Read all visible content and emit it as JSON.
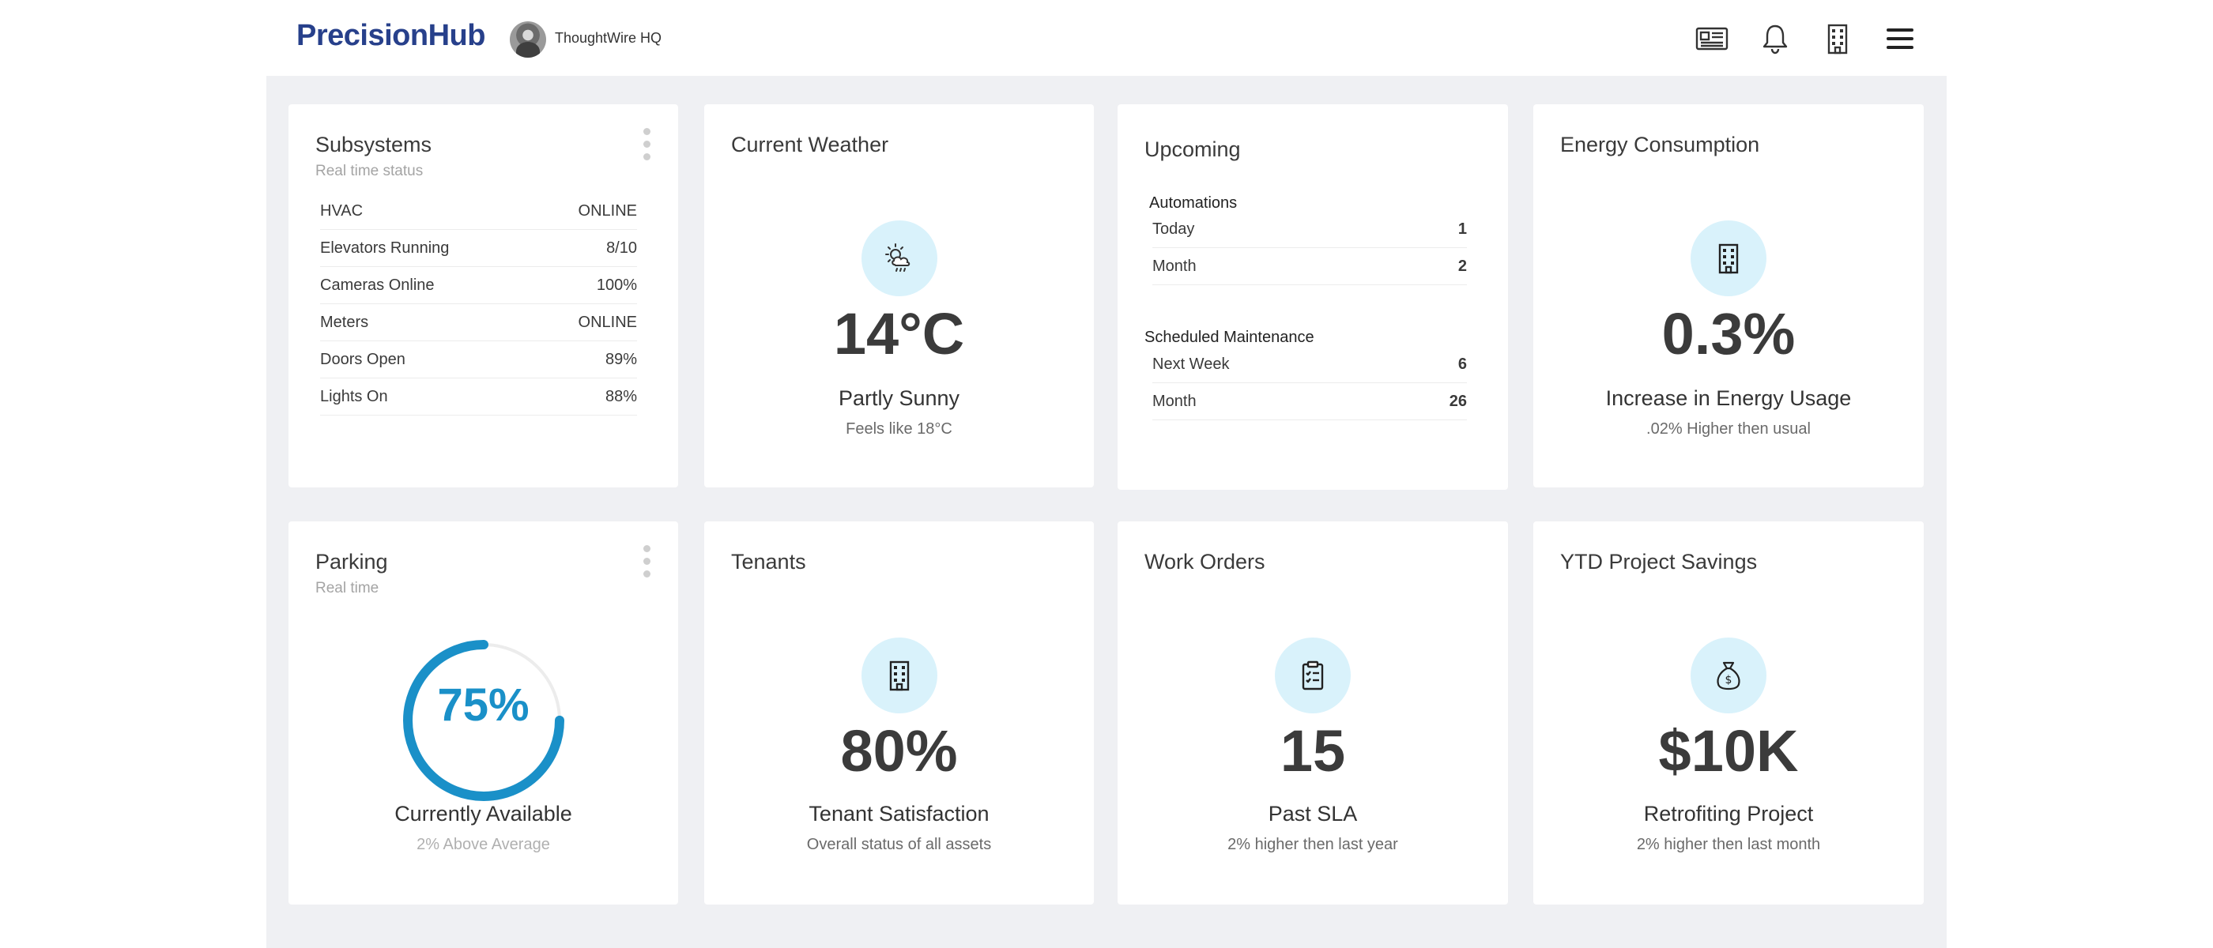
{
  "header": {
    "logo": "PrecisionHub",
    "site_name": "ThoughtWire HQ",
    "icons": [
      "news-icon",
      "bell-icon",
      "building-icon",
      "menu-icon"
    ]
  },
  "colors": {
    "accent": "#1a90c8",
    "brand": "#27408b",
    "icon_bg": "#d9f2fb",
    "panel_bg": "#eff0f3"
  },
  "subsystems": {
    "title": "Subsystems",
    "subtitle": "Real time status",
    "rows": [
      {
        "label": "HVAC",
        "value": "ONLINE"
      },
      {
        "label": "Elevators Running",
        "value": "8/10"
      },
      {
        "label": "Cameras Online",
        "value": "100%"
      },
      {
        "label": "Meters",
        "value": "ONLINE"
      },
      {
        "label": "Doors Open",
        "value": "89%"
      },
      {
        "label": "Lights On",
        "value": "88%"
      }
    ]
  },
  "weather": {
    "title": "Current Weather",
    "icon": "partly-sunny-icon",
    "temp": "14°C",
    "condition": "Partly Sunny",
    "feels_like": "Feels like 18°C"
  },
  "upcoming": {
    "title": "Upcoming",
    "automations": {
      "heading": "Automations",
      "rows": [
        {
          "label": "Today",
          "value": "1"
        },
        {
          "label": "Month",
          "value": "2"
        }
      ]
    },
    "maintenance": {
      "heading": "Scheduled Maintenance",
      "rows": [
        {
          "label": "Next Week",
          "value": "6"
        },
        {
          "label": "Month",
          "value": "26"
        }
      ]
    }
  },
  "energy": {
    "title": "Energy Consumption",
    "icon": "building-icon",
    "value": "0.3%",
    "label": "Increase in Energy Usage",
    "sub": ".02% Higher then usual"
  },
  "parking": {
    "title": "Parking",
    "subtitle": "Real time",
    "percent": 75,
    "value": "75%",
    "label": "Currently Available",
    "sub": "2% Above Average"
  },
  "tenants": {
    "title": "Tenants",
    "icon": "building-icon",
    "value": "80%",
    "label": "Tenant Satisfaction",
    "sub": "Overall status of all assets"
  },
  "work_orders": {
    "title": "Work Orders",
    "icon": "clipboard-icon",
    "value": "15",
    "label": "Past SLA",
    "sub": "2% higher then last year"
  },
  "savings": {
    "title": "YTD Project Savings",
    "icon": "money-bag-icon",
    "value": "$10K",
    "label": "Retrofiting Project",
    "sub": "2% higher then last month"
  }
}
